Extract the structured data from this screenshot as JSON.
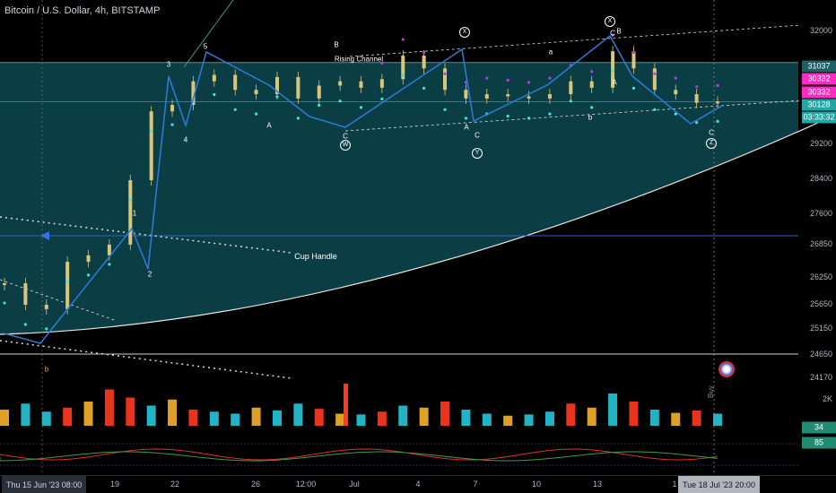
{
  "header": {
    "title": "Bitcoin / U.S. Dollar, 4h, BITSTAMP"
  },
  "colors": {
    "background": "#000000",
    "channel_fill": "#0b3d44",
    "wave_line": "#2f7bd9",
    "cyan_dots": "#3ee6d8",
    "magenta_dots": "#b83be0",
    "candle_body": "#d8c77a",
    "price_badge": "#ff2cc4",
    "current_badge": "#24a7a4",
    "volume_up": "#26c6da",
    "volume_down": "#ff3b1f",
    "volume_highlight": "#f6b12b"
  },
  "price_axis": {
    "ticks": [
      "32000",
      "30128",
      "29200",
      "28400",
      "27600",
      "26850",
      "26250",
      "25650",
      "25150",
      "24650",
      "24170",
      "2K"
    ],
    "badges": [
      {
        "text": "31037",
        "kind": "level"
      },
      {
        "text": "30332",
        "kind": "magenta"
      },
      {
        "text": "30332",
        "kind": "magenta"
      },
      {
        "text": "30128",
        "kind": "current"
      },
      {
        "text": "03:33:32",
        "kind": "countdown"
      },
      {
        "text": "34",
        "kind": "indicator"
      },
      {
        "text": "85",
        "kind": "indicator"
      }
    ]
  },
  "time_axis": {
    "start_label": "Thu 15 Jun '23   08:00",
    "ticks": [
      "19",
      "22",
      "26",
      "12:00",
      "Jul",
      "4",
      "7",
      "10",
      "13",
      "1"
    ],
    "cursor_label": "Tue 18 Jul '23   20:00"
  },
  "annotations": {
    "rising_channel": "Rising Channel",
    "cup_handle": "Cup Handle",
    "buy": "Buy",
    "wave_labels": [
      "3",
      "5",
      "4",
      "1",
      "2",
      "A",
      "B",
      "C",
      "A",
      "C",
      "a",
      "b",
      "C",
      "B",
      "A",
      "C",
      "b"
    ],
    "circled_labels": [
      "W",
      "X",
      "Y",
      "X",
      "Z"
    ]
  },
  "chart_data": {
    "type": "line",
    "title": "Bitcoin / U.S. Dollar, 4h, BITSTAMP",
    "symbol": "BTCUSD",
    "interval": "4h",
    "exchange": "BITSTAMP",
    "xlabel": "",
    "ylabel": "",
    "x_range": [
      "2023-06-15",
      "2023-07-18"
    ],
    "ylim": [
      24170,
      32200
    ],
    "current_price": 30128,
    "levels": {
      "resistance": 31037,
      "support": 24650,
      "horizontal_blue": 26970
    },
    "series": [
      {
        "name": "",
        "x": [
          "2023-06-14",
          "2023-06-15",
          "2023-06-16",
          "2023-06-17",
          "2023-06-18",
          "2023-06-19",
          "2023-06-20",
          "2023-06-21",
          "2023-06-22",
          "2023-06-23",
          "2023-06-24",
          "2023-06-25",
          "2023-06-26",
          "2023-06-27",
          "2023-06-28",
          "2023-06-29",
          "2023-06-30",
          "2023-07-01",
          "2023-07-02",
          "2023-07-03",
          "2023-07-04",
          "2023-07-05",
          "2023-07-06",
          "2023-07-07",
          "2023-07-08",
          "2023-07-09",
          "2023-07-10",
          "2023-07-11",
          "2023-07-12",
          "2023-07-13",
          "2023-07-14",
          "2023-07-15",
          "2023-07-16",
          "2023-07-17",
          "2023-07-18"
        ],
        "y": [
          25900,
          25400,
          25300,
          26400,
          26550,
          26800,
          28300,
          29900,
          30050,
          30600,
          30750,
          30400,
          30300,
          30700,
          30200,
          30500,
          30600,
          30450,
          30650,
          31200,
          30900,
          30400,
          30200,
          30300,
          30250,
          30200,
          30300,
          30600,
          30450,
          31300,
          30900,
          30400,
          30300,
          30100,
          30128
        ]
      }
    ],
    "volume": [
      40,
      55,
      35,
      45,
      60,
      90,
      70,
      50,
      65,
      40,
      35,
      30,
      45,
      38,
      55,
      42,
      30,
      28,
      35,
      50,
      45,
      60,
      40,
      30,
      25,
      28,
      35,
      55,
      45,
      80,
      60,
      40,
      32,
      38,
      30
    ]
  }
}
